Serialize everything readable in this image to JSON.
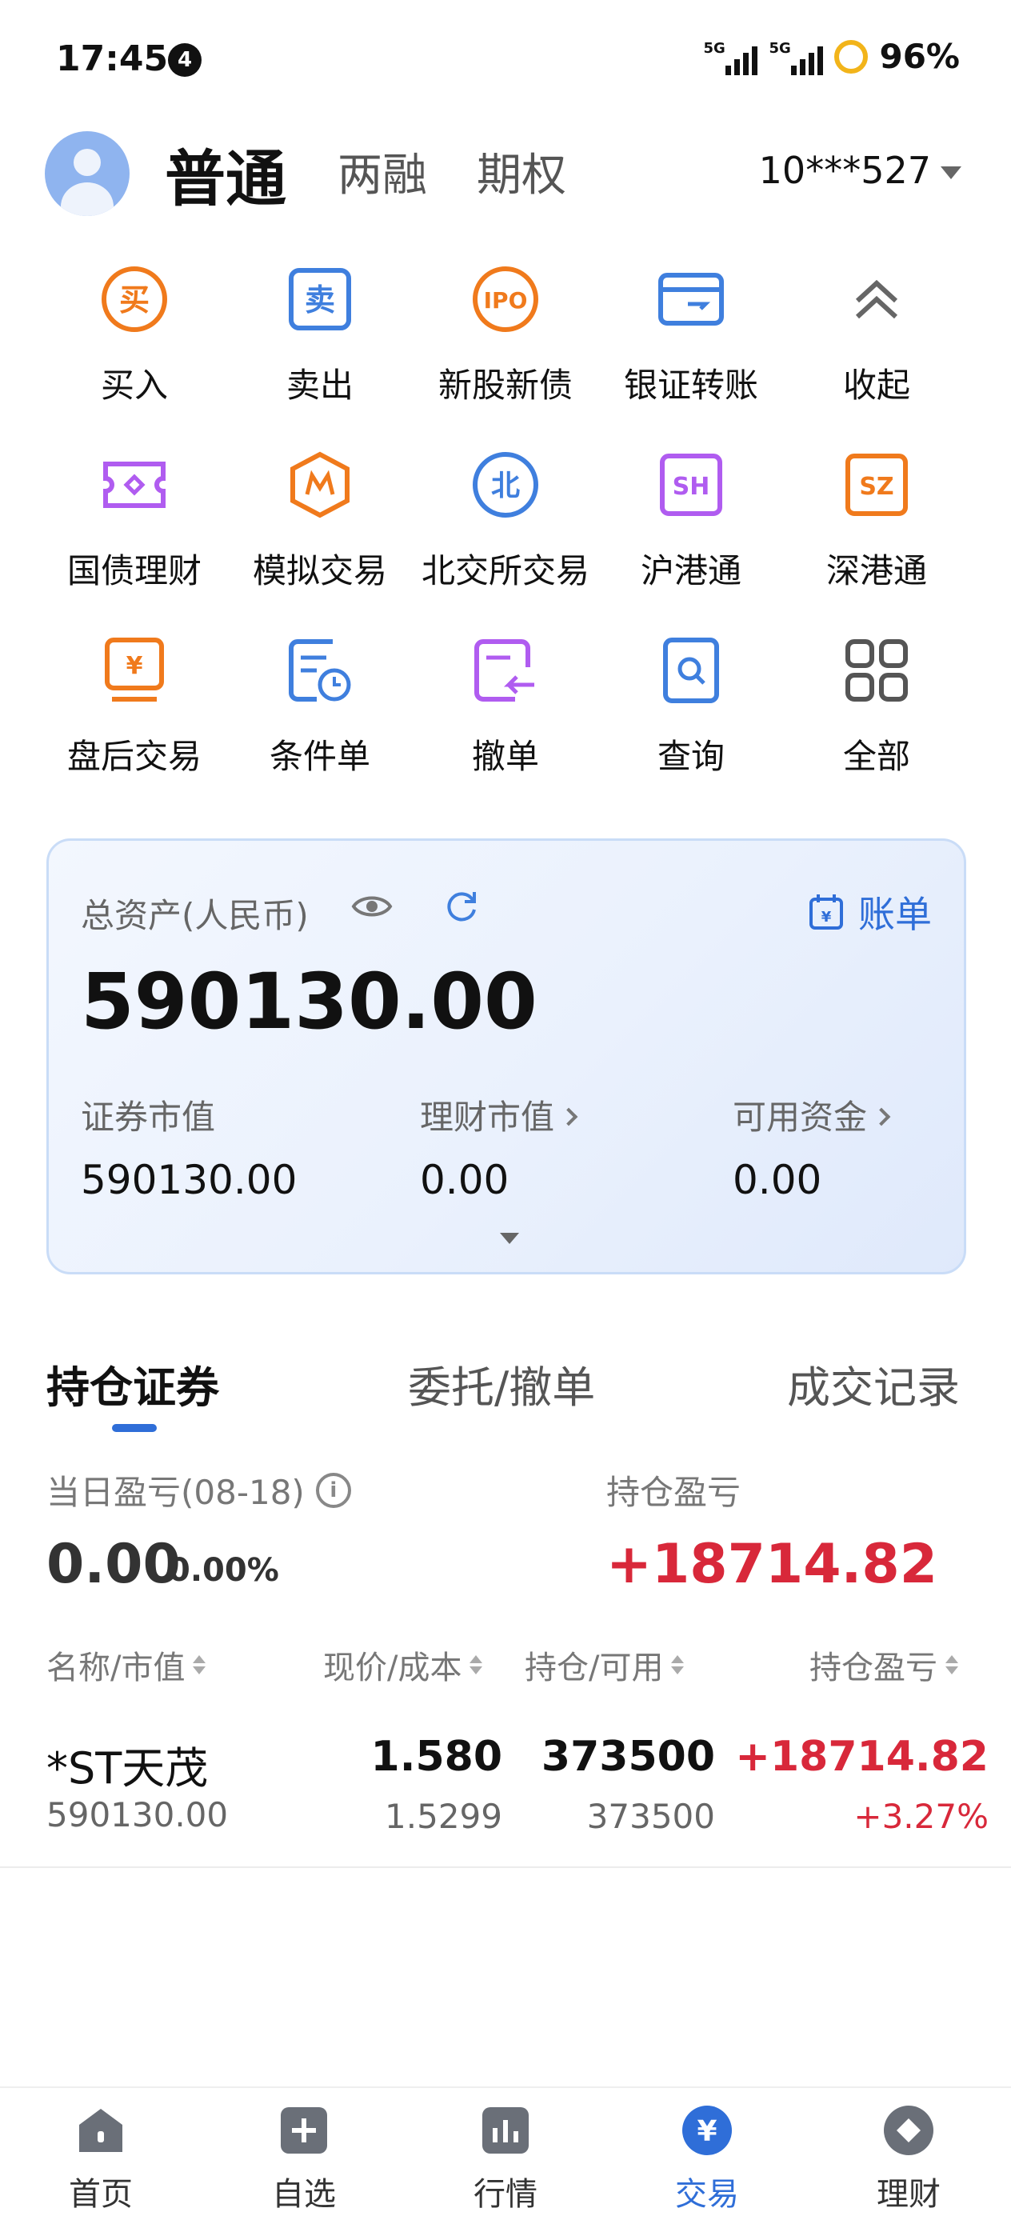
{
  "status_bar": {
    "time": "17:45",
    "notification_count": "4",
    "signal1": "5G",
    "signal2": "5G",
    "battery": "96%"
  },
  "account": {
    "tabs": [
      "普通",
      "两融",
      "期权"
    ],
    "active_tab": "普通",
    "account_number": "10***527"
  },
  "quick_actions": [
    {
      "label": "买入",
      "icon": "buy-icon",
      "color": "#f07a1c"
    },
    {
      "label": "卖出",
      "icon": "sell-icon",
      "color": "#3f7fde"
    },
    {
      "label": "新股新债",
      "icon": "ipo-icon",
      "color": "#f07a1c"
    },
    {
      "label": "银证转账",
      "icon": "bank-transfer-icon",
      "color": "#3f7fde"
    },
    {
      "label": "收起",
      "icon": "collapse-icon",
      "color": "#666666"
    },
    {
      "label": "国债理财",
      "icon": "treasury-icon",
      "color": "#b05cf0"
    },
    {
      "label": "模拟交易",
      "icon": "simulation-icon",
      "color": "#f07a1c"
    },
    {
      "label": "北交所交易",
      "icon": "bse-icon",
      "color": "#3f7fde",
      "glyph": "北"
    },
    {
      "label": "沪港通",
      "icon": "sh-hk-connect-icon",
      "color": "#b05cf0",
      "glyph": "SH"
    },
    {
      "label": "深港通",
      "icon": "sz-hk-connect-icon",
      "color": "#f07a1c",
      "glyph": "SZ"
    },
    {
      "label": "盘后交易",
      "icon": "after-hours-icon",
      "color": "#f07a1c",
      "glyph": "¥"
    },
    {
      "label": "条件单",
      "icon": "conditional-order-icon",
      "color": "#3f7fde"
    },
    {
      "label": "撤单",
      "icon": "cancel-order-icon",
      "color": "#b05cf0"
    },
    {
      "label": "查询",
      "icon": "query-icon",
      "color": "#3f7fde"
    },
    {
      "label": "全部",
      "icon": "all-apps-icon",
      "color": "#555555"
    }
  ],
  "assets": {
    "total_label": "总资产(人民币)",
    "total_value": "590130.00",
    "bill_label": "账单",
    "securities_label": "证券市值",
    "securities_value": "590130.00",
    "wealth_label": "理财市值",
    "wealth_value": "0.00",
    "available_label": "可用资金",
    "available_value": "0.00"
  },
  "section_tabs": [
    "持仓证券",
    "委托/撤单",
    "成交记录"
  ],
  "pnl": {
    "today_label": "当日盈亏(08-18)",
    "today_value": "0.00",
    "today_pct": "0.00%",
    "position_label": "持仓盈亏",
    "position_value": "+18714.82"
  },
  "table": {
    "headers": [
      "名称/市值",
      "现价/成本",
      "持仓/可用",
      "持仓盈亏"
    ],
    "rows": [
      {
        "name": "*ST天茂",
        "market_value": "590130.00",
        "price": "1.580",
        "cost": "1.5299",
        "position": "373500",
        "available": "373500",
        "pnl": "+18714.82",
        "pnl_pct": "+3.27%"
      }
    ]
  },
  "bottom_nav": [
    {
      "label": "首页",
      "icon": "home-icon"
    },
    {
      "label": "自选",
      "icon": "watchlist-icon"
    },
    {
      "label": "行情",
      "icon": "market-icon"
    },
    {
      "label": "交易",
      "icon": "trade-icon",
      "active": true
    },
    {
      "label": "理财",
      "icon": "wealth-icon"
    }
  ],
  "colors": {
    "accent": "#2f6ed8",
    "profit": "#d8283a"
  }
}
